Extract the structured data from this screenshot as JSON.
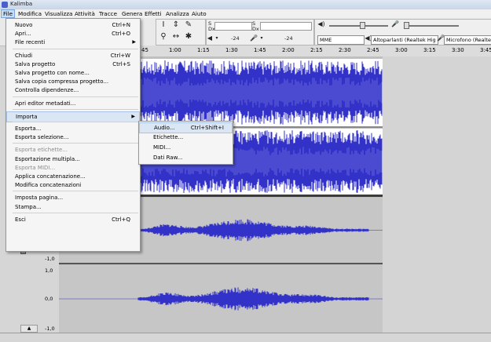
{
  "window": {
    "title": "Kalimba"
  },
  "menubar": [
    "File",
    "Modifica",
    "Visualizza",
    "Attività",
    "Tracce",
    "Genera",
    "Effetti",
    "Analizza",
    "Aiuto"
  ],
  "meters": {
    "mic_db": "-24",
    "speaker_db": "-24",
    "left_letter_1": "S",
    "left_letter_2": "Dx",
    "right_letter_1": "S",
    "right_letter_2": "Dx"
  },
  "devices": {
    "host": "MME",
    "output": "Altoparlanti (Realtek Hig",
    "input": "Microfono (Realtek Hig"
  },
  "timeline": {
    "ticks": [
      "45",
      "1:00",
      "1:15",
      "1:30",
      "1:45",
      "2:00",
      "2:15",
      "2:30",
      "2:45",
      "3:00",
      "3:15",
      "3:30",
      "3:45"
    ]
  },
  "yaxis": {
    "labels": [
      "-1,0",
      "1,0",
      "0,0",
      "-1,0"
    ]
  },
  "file_menu": [
    {
      "label": "Nuovo",
      "shortcut": "Ctrl+N",
      "state": "normal"
    },
    {
      "label": "Apri...",
      "shortcut": "Ctrl+O",
      "state": "normal"
    },
    {
      "label": "File recenti",
      "shortcut": "",
      "state": "submenu"
    },
    {
      "sep": true
    },
    {
      "label": "Chiudi",
      "shortcut": "Ctrl+W",
      "state": "normal"
    },
    {
      "label": "Salva progetto",
      "shortcut": "Ctrl+S",
      "state": "normal"
    },
    {
      "label": "Salva progetto con nome...",
      "shortcut": "",
      "state": "normal"
    },
    {
      "label": "Salva copia compressa progetto...",
      "shortcut": "",
      "state": "normal"
    },
    {
      "label": "Controlla dipendenze...",
      "shortcut": "",
      "state": "normal"
    },
    {
      "sep": true
    },
    {
      "label": "Apri editor metadati...",
      "shortcut": "",
      "state": "normal"
    },
    {
      "sep": true
    },
    {
      "label": "Importa",
      "shortcut": "",
      "state": "hover-submenu"
    },
    {
      "sep": true
    },
    {
      "label": "Esporta...",
      "shortcut": "",
      "state": "normal"
    },
    {
      "label": "Esporta selezione...",
      "shortcut": "",
      "state": "normal"
    },
    {
      "sep": true
    },
    {
      "label": "Esporta etichette...",
      "shortcut": "",
      "state": "disabled"
    },
    {
      "label": "Esportazione multipla...",
      "shortcut": "",
      "state": "normal"
    },
    {
      "label": "Esporta MIDI...",
      "shortcut": "",
      "state": "disabled"
    },
    {
      "label": "Applica concatenazione...",
      "shortcut": "",
      "state": "normal"
    },
    {
      "label": "Modifica concatenazioni",
      "shortcut": "",
      "state": "normal"
    },
    {
      "sep": true
    },
    {
      "label": "Imposta pagina...",
      "shortcut": "",
      "state": "normal"
    },
    {
      "label": "Stampa...",
      "shortcut": "",
      "state": "normal"
    },
    {
      "sep": true
    },
    {
      "label": "Esci",
      "shortcut": "Ctrl+Q",
      "state": "normal"
    }
  ],
  "import_submenu": [
    {
      "label": "Audio...",
      "shortcut": "Ctrl+Shift+I",
      "state": "hover"
    },
    {
      "label": "Etichette...",
      "shortcut": "",
      "state": "normal"
    },
    {
      "label": "MIDI...",
      "shortcut": "",
      "state": "normal"
    },
    {
      "label": "Dati Raw...",
      "shortcut": "",
      "state": "normal"
    }
  ],
  "colors": {
    "waveform": "#3232c8",
    "waveform_light": "#6464dc",
    "menu_hover": "#dbe6f4"
  },
  "icons": {
    "collapse": "▲"
  }
}
